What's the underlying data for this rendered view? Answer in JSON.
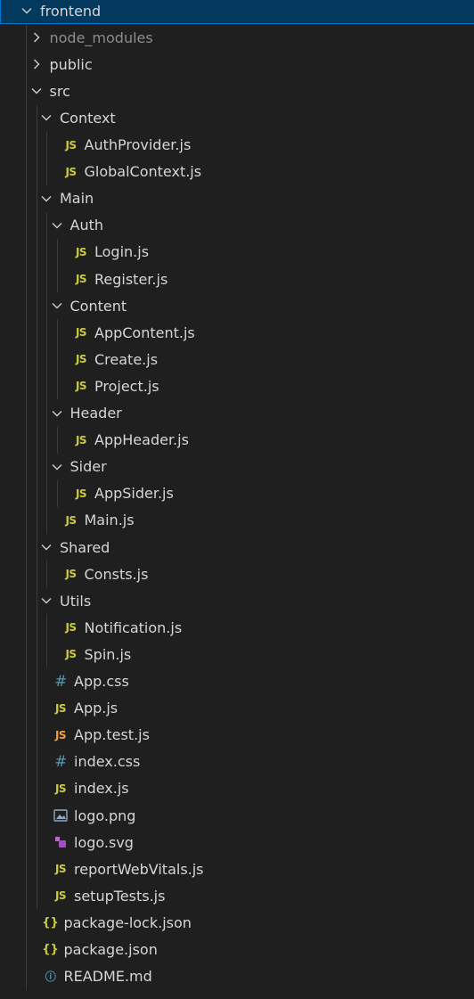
{
  "tree": [
    {
      "label": "frontend",
      "type": "folder",
      "open": true,
      "depth": 0,
      "selected": true
    },
    {
      "label": "node_modules",
      "type": "folder",
      "open": false,
      "depth": 1,
      "dim": true
    },
    {
      "label": "public",
      "type": "folder",
      "open": false,
      "depth": 1
    },
    {
      "label": "src",
      "type": "folder",
      "open": true,
      "depth": 1
    },
    {
      "label": "Context",
      "type": "folder",
      "open": true,
      "depth": 2
    },
    {
      "label": "AuthProvider.js",
      "type": "file",
      "icon": "js",
      "depth": 3
    },
    {
      "label": "GlobalContext.js",
      "type": "file",
      "icon": "js",
      "depth": 3
    },
    {
      "label": "Main",
      "type": "folder",
      "open": true,
      "depth": 2
    },
    {
      "label": "Auth",
      "type": "folder",
      "open": true,
      "depth": 3
    },
    {
      "label": "Login.js",
      "type": "file",
      "icon": "js",
      "depth": 4
    },
    {
      "label": "Register.js",
      "type": "file",
      "icon": "js",
      "depth": 4
    },
    {
      "label": "Content",
      "type": "folder",
      "open": true,
      "depth": 3
    },
    {
      "label": "AppContent.js",
      "type": "file",
      "icon": "js",
      "depth": 4
    },
    {
      "label": "Create.js",
      "type": "file",
      "icon": "js",
      "depth": 4
    },
    {
      "label": "Project.js",
      "type": "file",
      "icon": "js",
      "depth": 4
    },
    {
      "label": "Header",
      "type": "folder",
      "open": true,
      "depth": 3
    },
    {
      "label": "AppHeader.js",
      "type": "file",
      "icon": "js",
      "depth": 4
    },
    {
      "label": "Sider",
      "type": "folder",
      "open": true,
      "depth": 3
    },
    {
      "label": "AppSider.js",
      "type": "file",
      "icon": "js",
      "depth": 4
    },
    {
      "label": "Main.js",
      "type": "file",
      "icon": "js",
      "depth": 3
    },
    {
      "label": "Shared",
      "type": "folder",
      "open": true,
      "depth": 2
    },
    {
      "label": "Consts.js",
      "type": "file",
      "icon": "js",
      "depth": 3
    },
    {
      "label": "Utils",
      "type": "folder",
      "open": true,
      "depth": 2
    },
    {
      "label": "Notification.js",
      "type": "file",
      "icon": "js",
      "depth": 3
    },
    {
      "label": "Spin.js",
      "type": "file",
      "icon": "js",
      "depth": 3
    },
    {
      "label": "App.css",
      "type": "file",
      "icon": "css",
      "depth": 2
    },
    {
      "label": "App.js",
      "type": "file",
      "icon": "js",
      "depth": 2
    },
    {
      "label": "App.test.js",
      "type": "file",
      "icon": "test",
      "depth": 2
    },
    {
      "label": "index.css",
      "type": "file",
      "icon": "css",
      "depth": 2
    },
    {
      "label": "index.js",
      "type": "file",
      "icon": "js",
      "depth": 2
    },
    {
      "label": "logo.png",
      "type": "file",
      "icon": "image",
      "depth": 2
    },
    {
      "label": "logo.svg",
      "type": "file",
      "icon": "svg",
      "depth": 2
    },
    {
      "label": "reportWebVitals.js",
      "type": "file",
      "icon": "js",
      "depth": 2
    },
    {
      "label": "setupTests.js",
      "type": "file",
      "icon": "js",
      "depth": 2
    },
    {
      "label": "package-lock.json",
      "type": "file",
      "icon": "json",
      "depth": 1
    },
    {
      "label": "package.json",
      "type": "file",
      "icon": "json",
      "depth": 1
    },
    {
      "label": "README.md",
      "type": "file",
      "icon": "info",
      "depth": 1
    }
  ],
  "icons": {
    "js": {
      "glyph": "JS",
      "name": "js-file-icon"
    },
    "test": {
      "glyph": "JS",
      "name": "test-js-file-icon"
    },
    "css": {
      "glyph": "#",
      "name": "css-file-icon"
    },
    "json": {
      "glyph": "{}",
      "name": "json-file-icon"
    },
    "info": {
      "glyph": "ⓘ",
      "name": "info-file-icon"
    },
    "image": {
      "glyph": "",
      "name": "image-file-icon"
    },
    "svg": {
      "glyph": "",
      "name": "svg-file-icon"
    }
  },
  "colors": {
    "background": "#1f1f1f",
    "selection": "#04395e",
    "selection_border": "#0078d4",
    "js": "#cbcb41",
    "css": "#519aba",
    "test": "#f0a040",
    "text": "#d6d6d6",
    "dim_text": "#8c8c8c"
  }
}
